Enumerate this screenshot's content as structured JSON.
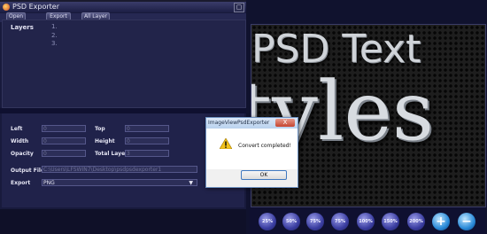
{
  "app": {
    "title": "PSD Exporter",
    "toolbar": [
      "Open",
      "Export",
      "All Layer"
    ],
    "layers_label": "Layers",
    "layer_items": [
      "1.",
      "2.",
      "3."
    ]
  },
  "properties": {
    "left": {
      "label": "Left",
      "value": "0"
    },
    "top": {
      "label": "Top",
      "value": "0"
    },
    "width": {
      "label": "Width",
      "value": "0"
    },
    "height": {
      "label": "Height",
      "value": "0"
    },
    "opacity": {
      "label": "Opacity",
      "value": "0"
    },
    "total_layer": {
      "label": "Total Layer",
      "value": "3"
    },
    "output_file": {
      "label": "Output File",
      "value": "C:\\Users\\LFSWIN7\\Desktop\\psdpsdexporter1"
    },
    "export": {
      "label": "Export",
      "value": "PNG"
    }
  },
  "image_text": {
    "line1": "PSD Text",
    "line2": "tyles"
  },
  "zoom": [
    "25%",
    "50%",
    "75%",
    "75%",
    "100%",
    "150%",
    "200%"
  ],
  "dialog": {
    "title": "ImageViewPsdExporter",
    "close": "X",
    "message": "Convert completed!",
    "ok": "OK"
  },
  "colors": {
    "window_bg": "#181a3c",
    "zoom_button": "#3a3da0",
    "dialog_border": "#6b8fbf"
  }
}
